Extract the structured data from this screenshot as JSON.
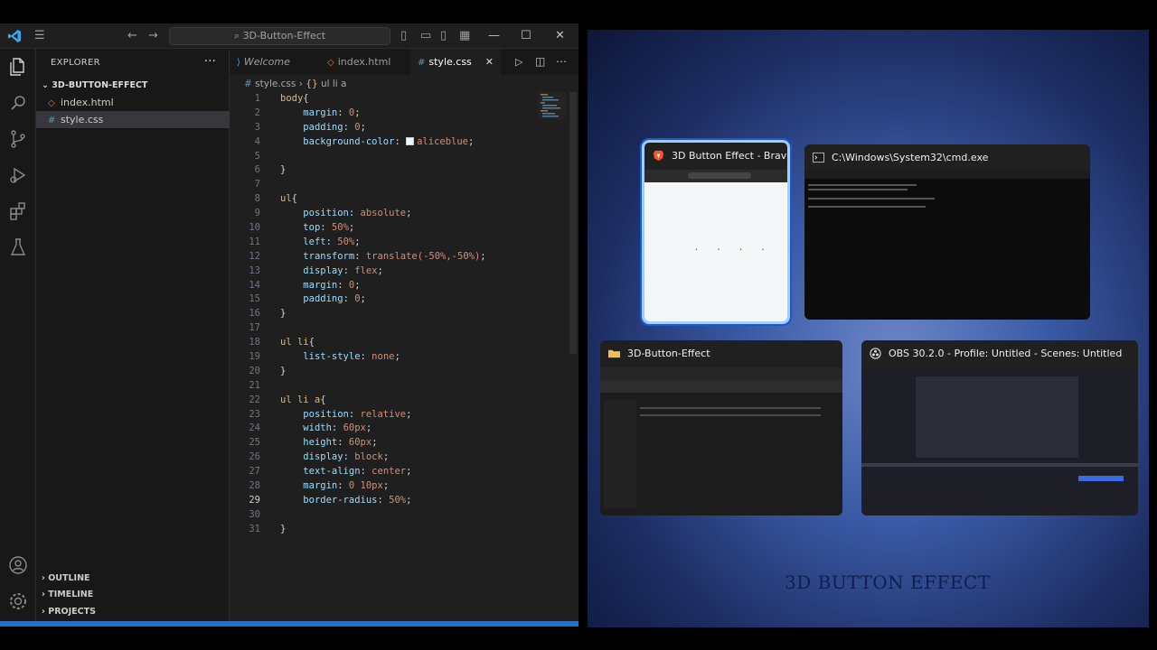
{
  "vscode": {
    "search_text": "3D-Button-Effect",
    "explorer_title": "EXPLORER",
    "explorer_more": "···",
    "folder_name": "3D-BUTTON-EFFECT",
    "files": [
      {
        "name": "index.html",
        "icon": "html-icon",
        "active": false
      },
      {
        "name": "style.css",
        "icon": "css-icon",
        "active": true
      }
    ],
    "sections": [
      "OUTLINE",
      "TIMELINE",
      "PROJECTS"
    ],
    "tabs": [
      {
        "label": "Welcome",
        "icon": "vscode-icon"
      },
      {
        "label": "index.html",
        "icon": "html-icon"
      },
      {
        "label": "style.css",
        "icon": "css-icon"
      }
    ],
    "breadcrumb": [
      "style.css",
      "ul li a"
    ],
    "current_line": 29,
    "code_lines": [
      "body{",
      "    margin: 0;",
      "    padding: 0;",
      "    background-color: aliceblue;",
      "",
      "}",
      "",
      "ul{",
      "    position: absolute;",
      "    top: 50%;",
      "    left: 50%;",
      "    transform: translate(-50%,-50%);",
      "    display:flex;",
      "    margin: 0;",
      "    padding: 0;",
      "}",
      "",
      "ul li{",
      "    list-style: none;",
      "}",
      "",
      "ul li a{",
      "    position: relative;",
      "    width: 60px;",
      "    height: 60px;",
      "    display: block;",
      "    text-align: center;",
      "    margin: 0 10px;",
      "    border-radius: 50%;",
      "",
      "}"
    ]
  },
  "switcher": {
    "windows": [
      {
        "id": "brave",
        "title": "3D Button Effect - Brave",
        "icon": "brave-icon"
      },
      {
        "id": "cmd",
        "title": "C:\\Windows\\System32\\cmd.exe",
        "icon": "terminal-icon"
      },
      {
        "id": "explorer",
        "title": "3D-Button-Effect",
        "icon": "folder-icon"
      },
      {
        "id": "obs",
        "title": "OBS 30.2.0 - Profile: Untitled - Scenes: Untitled",
        "icon": "obs-icon"
      }
    ],
    "caption": "3D BUTTON EFFECT"
  },
  "colors": {
    "accent_blue": "#2571c9",
    "selector": "#d7ba7d",
    "property": "#9cdcfe",
    "value": "#ce9178"
  }
}
